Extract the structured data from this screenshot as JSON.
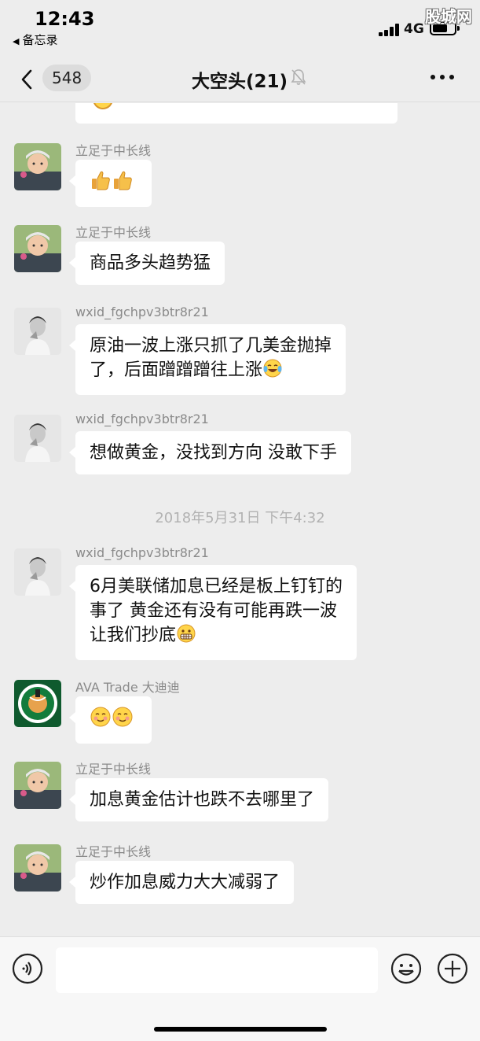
{
  "status_bar": {
    "time": "12:43",
    "back_to_app": "备忘录",
    "network": "4G",
    "watermark": "股城网"
  },
  "nav": {
    "unread_count": "548",
    "title": "大空头(21)",
    "muted": true
  },
  "messages": [
    {
      "sender": "立足于中长线",
      "lines": [],
      "emojis": [
        "thumbs-up",
        "thumbs-up"
      ],
      "avatar": "child-photo"
    },
    {
      "sender": "立足于中长线",
      "lines": [
        "商品多头趋势猛"
      ],
      "avatar": "child-photo"
    },
    {
      "sender": "wxid_fgchpv3btr8r21",
      "lines": [
        "原油一波上涨只抓了几美金抛掉",
        "了，后面蹭蹭蹭往上涨"
      ],
      "emojis": [
        "tears-of-joy"
      ],
      "avatar": "man-photo"
    },
    {
      "sender": "wxid_fgchpv3btr8r21",
      "lines": [
        "想做黄金，没找到方向  没敢下手"
      ],
      "avatar": "man-photo"
    },
    {
      "sender": "wxid_fgchpv3btr8r21",
      "lines": [
        "6月美联储加息已经是板上钉钉的",
        "事了  黄金还有没有可能再跌一波",
        "让我们抄底"
      ],
      "emojis": [
        "grimace"
      ],
      "avatar": "man-photo"
    },
    {
      "sender": "AVA Trade 大迪迪",
      "lines": [],
      "emojis": [
        "blush",
        "blush"
      ],
      "avatar": "celtics-logo"
    },
    {
      "sender": "立足于中长线",
      "lines": [
        "加息黄金估计也跌不去哪里了"
      ],
      "avatar": "child-photo"
    },
    {
      "sender": "立足于中长线",
      "lines": [
        "炒作加息威力大大减弱了"
      ],
      "avatar": "child-photo"
    }
  ],
  "timestamp": "2018年5月31日 下午4:32",
  "input_bar": {
    "placeholder": "",
    "voice_icon": "voice-icon",
    "emoji_icon": "smiley-icon",
    "plus_icon": "plus-icon"
  }
}
